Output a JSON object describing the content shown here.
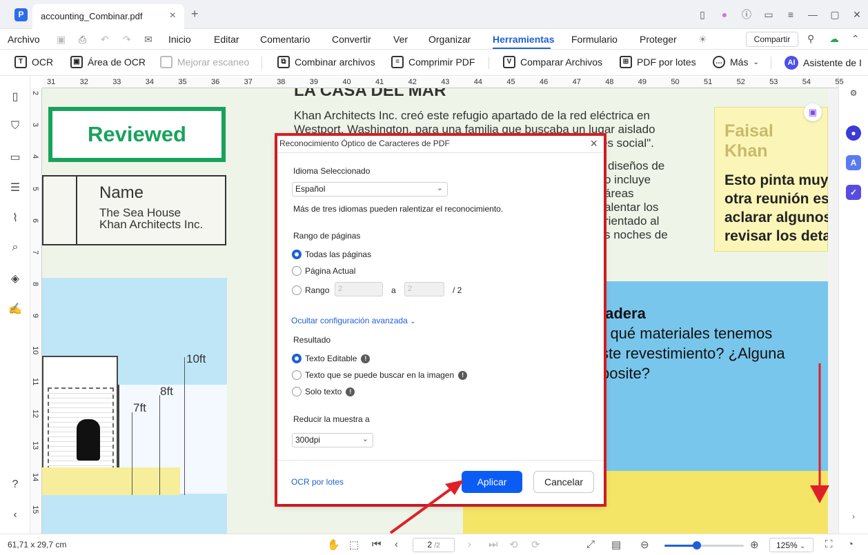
{
  "window": {
    "tab_title": "accounting_Combinar.pdf",
    "app_logo": "P"
  },
  "menu": {
    "archivo": "Archivo",
    "items": [
      "Inicio",
      "Editar",
      "Comentario",
      "Convertir",
      "Ver",
      "Organizar",
      "Herramientas",
      "Formulario",
      "Proteger"
    ],
    "active": "Herramientas",
    "share": "Compartir"
  },
  "toolbar": {
    "ocr": "OCR",
    "area_ocr": "Área de OCR",
    "mejorar": "Mejorar escaneo",
    "combinar": "Combinar archivos",
    "comprimir": "Comprimir PDF",
    "comparar": "Comparar Archivos",
    "lotes": "PDF por lotes",
    "mas": "Más",
    "asistente": "Asistente de I"
  },
  "ruler_top": [
    "31",
    "32",
    "33",
    "34",
    "35",
    "36",
    "37",
    "38",
    "39",
    "40",
    "41",
    "42",
    "43",
    "44",
    "45",
    "46",
    "47",
    "48",
    "49",
    "50",
    "51",
    "52",
    "53",
    "54",
    "55"
  ],
  "ruler_left": [
    "2",
    "3",
    "4",
    "5",
    "6",
    "7",
    "8",
    "9",
    "10",
    "11",
    "12",
    "13",
    "14",
    "15"
  ],
  "document": {
    "heading_fragment": "LA CASA DEL MAR",
    "reviewed": "Reviewed",
    "name_label": "Name",
    "name_line1": "The Sea House",
    "name_line2": "Khan Architects Inc.",
    "article_lines": [
      "Khan Architects Inc. creó este refugio apartado de la red eléctrica en",
      "Westport, Washington, para una familia que buscaba un lugar aislado",
      "és social\".",
      "diseños de",
      "o incluye áreas",
      "alentar los",
      "rientado al",
      "s noches de"
    ],
    "note_title": "Faisal Khan",
    "note_lines": [
      "Esto pinta muy",
      "otra reunión es",
      "aclarar algunos",
      "revisar los deta"
    ],
    "madera_title": "ladera",
    "madera_lines": [
      "r qué materiales tenemos",
      "ste revestimiento? ¿Alguna",
      "posite?"
    ],
    "dims": [
      "10ft",
      "8ft",
      "7ft"
    ]
  },
  "dialog": {
    "title": "Reconocimiento Óptico de Caracteres de PDF",
    "idioma_label": "Idioma Seleccionado",
    "idioma_value": "Español",
    "idioma_hint": "Más de tres idiomas pueden ralentizar el reconocimiento.",
    "rango_label": "Rango de páginas",
    "todas": "Todas las páginas",
    "actual": "Página Actual",
    "rango": "Rango",
    "rango_from": "2",
    "rango_a": "a",
    "rango_to": "2",
    "rango_total": "/ 2",
    "ocultar": "Ocultar configuración avanzada",
    "resultado_label": "Resultado",
    "texto_editable": "Texto Editable",
    "texto_buscable": "Texto que se puede buscar en la imagen",
    "solo_texto": "Solo texto",
    "reducir_label": "Reducir la muestra a",
    "dpi_value": "300dpi",
    "ocr_lotes": "OCR por lotes",
    "aplicar": "Aplicar",
    "cancelar": "Cancelar"
  },
  "status": {
    "dimensions": "61,71 x 29,7 cm",
    "page_current": "2",
    "page_total": "/2",
    "zoom": "125%",
    "zoom_fraction": 0.41
  },
  "colors": {
    "accent": "#1f5fd6",
    "highlight_frame": "#e02028",
    "reviewed_green": "#17a35b"
  }
}
